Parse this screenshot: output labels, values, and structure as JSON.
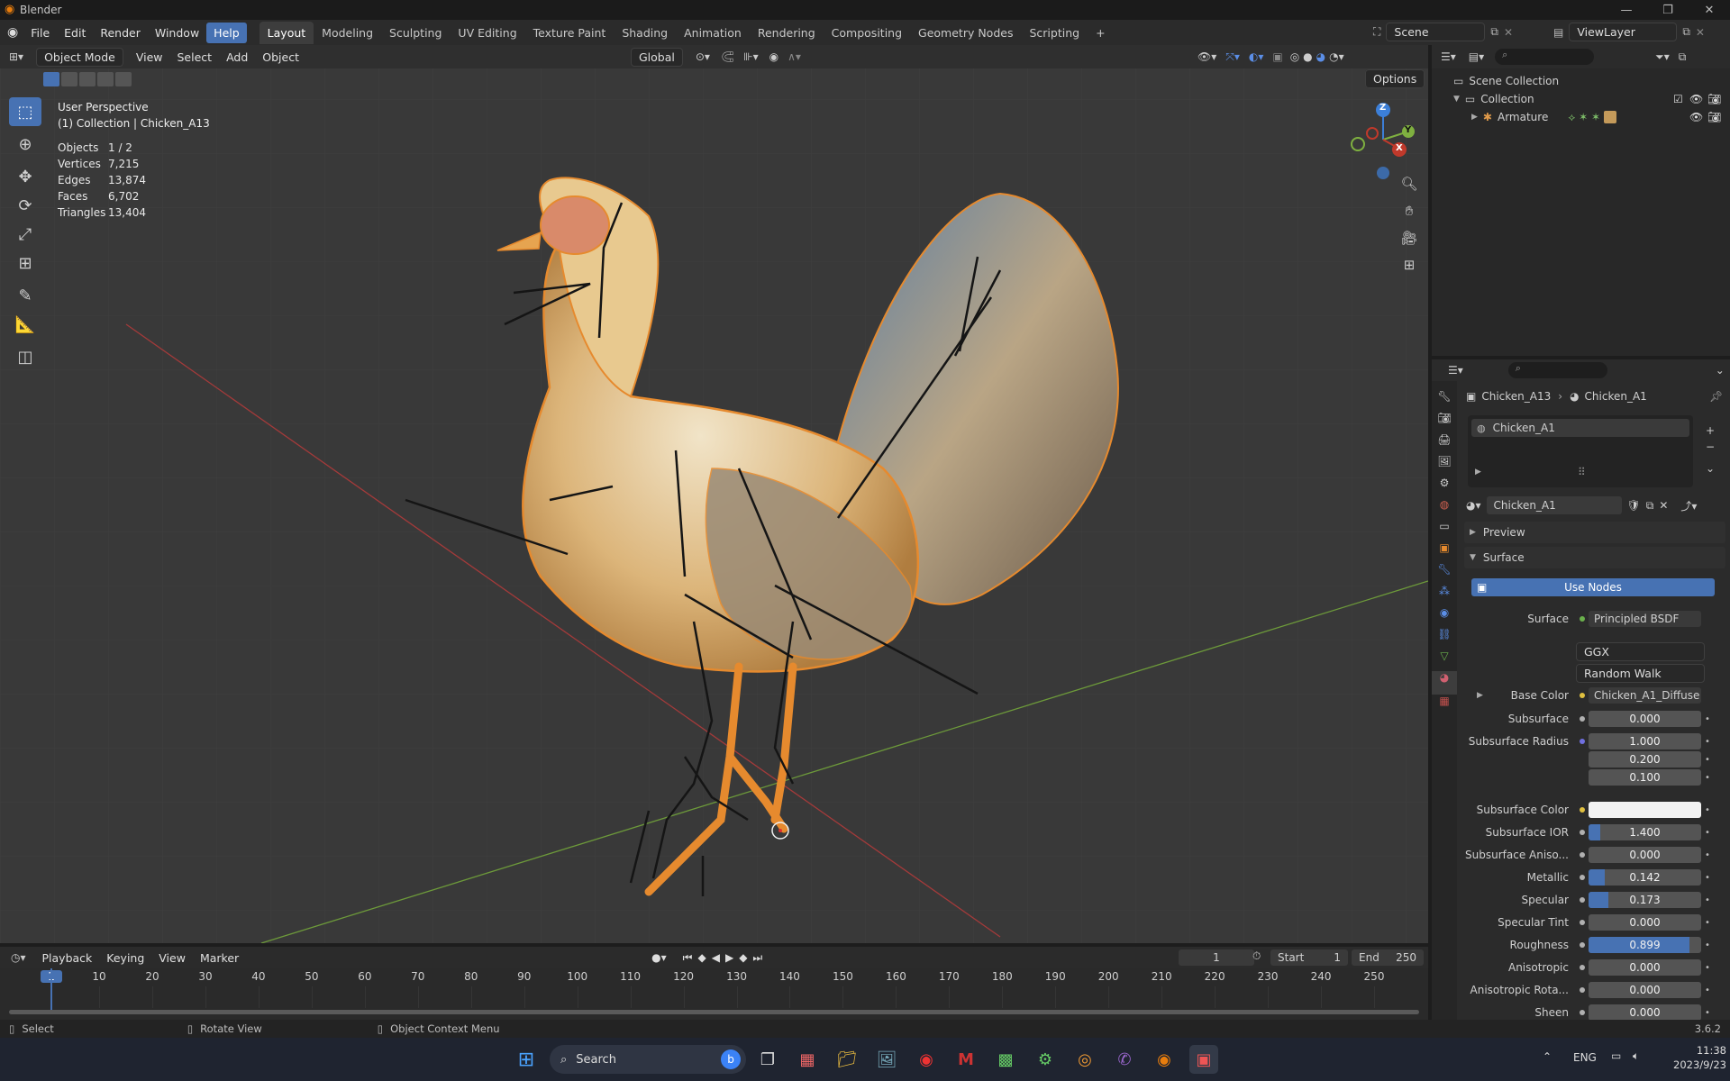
{
  "window": {
    "title": "Blender"
  },
  "menu": [
    "File",
    "Edit",
    "Render",
    "Window",
    "Help"
  ],
  "workspaces": [
    "Layout",
    "Modeling",
    "Sculpting",
    "UV Editing",
    "Texture Paint",
    "Shading",
    "Animation",
    "Rendering",
    "Compositing",
    "Geometry Nodes",
    "Scripting"
  ],
  "scene": {
    "scene_name": "Scene",
    "view_layer": "ViewLayer"
  },
  "viewport_header": {
    "mode": "Object Mode",
    "menus": [
      "View",
      "Select",
      "Add",
      "Object"
    ],
    "orientation": "Global",
    "options": "Options"
  },
  "viewport_overlay": {
    "perspective": "User Perspective",
    "collection_info": "(1) Collection | Chicken_A13",
    "stats": [
      {
        "label": "Objects",
        "value": "1 / 2"
      },
      {
        "label": "Vertices",
        "value": "7,215"
      },
      {
        "label": "Edges",
        "value": "13,874"
      },
      {
        "label": "Faces",
        "value": "6,702"
      },
      {
        "label": "Triangles",
        "value": "13,404"
      }
    ]
  },
  "gizmo": {
    "z": "Z",
    "y": "Y",
    "x": "X"
  },
  "outliner": {
    "root": "Scene Collection",
    "collection": "Collection",
    "armature": "Armature"
  },
  "properties": {
    "breadcrumb_object": "Chicken_A13",
    "breadcrumb_material": "Chicken_A1",
    "slot_name": "Chicken_A1",
    "material_name": "Chicken_A1",
    "preview_label": "Preview",
    "surface_label": "Surface",
    "use_nodes": "Use Nodes",
    "surface_shader_label": "Surface",
    "surface_shader": "Principled BSDF",
    "distribution": "GGX",
    "subsurface_method": "Random Walk",
    "base_color_label": "Base Color",
    "base_color_texture": "Chicken_A1_Diffuse",
    "rows": [
      {
        "label": "Subsurface",
        "value": "0.000",
        "fill": 0
      },
      {
        "label": "Subsurface Radius",
        "value": "1.000",
        "fill": 0
      },
      {
        "label": "",
        "value": "0.200",
        "fill": 0
      },
      {
        "label": "",
        "value": "0.100",
        "fill": 0
      },
      {
        "label": "Subsurface Color",
        "value": "",
        "fill": 0,
        "color": "#f2f2f2"
      },
      {
        "label": "Subsurface IOR",
        "value": "1.400",
        "fill": 0.1
      },
      {
        "label": "Subsurface Aniso...",
        "value": "0.000",
        "fill": 0
      },
      {
        "label": "Metallic",
        "value": "0.142",
        "fill": 0.142
      },
      {
        "label": "Specular",
        "value": "0.173",
        "fill": 0.173
      },
      {
        "label": "Specular Tint",
        "value": "0.000",
        "fill": 0
      },
      {
        "label": "Roughness",
        "value": "0.899",
        "fill": 0.899
      },
      {
        "label": "Anisotropic",
        "value": "0.000",
        "fill": 0
      },
      {
        "label": "Anisotropic Rota...",
        "value": "0.000",
        "fill": 0
      },
      {
        "label": "Sheen",
        "value": "0.000",
        "fill": 0
      }
    ]
  },
  "timeline": {
    "menus": [
      "Playback",
      "Keying",
      "View",
      "Marker"
    ],
    "current_frame": "1",
    "start_label": "Start",
    "start": "1",
    "end_label": "End",
    "end": "250",
    "ticks": [
      "1",
      "10",
      "20",
      "30",
      "40",
      "50",
      "60",
      "70",
      "80",
      "90",
      "100",
      "110",
      "120",
      "130",
      "140",
      "150",
      "160",
      "170",
      "180",
      "190",
      "200",
      "210",
      "220",
      "230",
      "240",
      "250"
    ]
  },
  "statusbar": {
    "select": "Select",
    "rotate": "Rotate View",
    "context": "Object Context Menu",
    "version": "3.6.2"
  },
  "taskbar": {
    "search": "Search",
    "lang": "ENG",
    "time": "11:38",
    "date": "2023/9/23"
  },
  "colors": {
    "accent": "#4772b3",
    "selection": "#e68a2e",
    "x_axis": "#c0392b",
    "y_axis": "#7fb040",
    "z_axis": "#3c7fd8"
  }
}
